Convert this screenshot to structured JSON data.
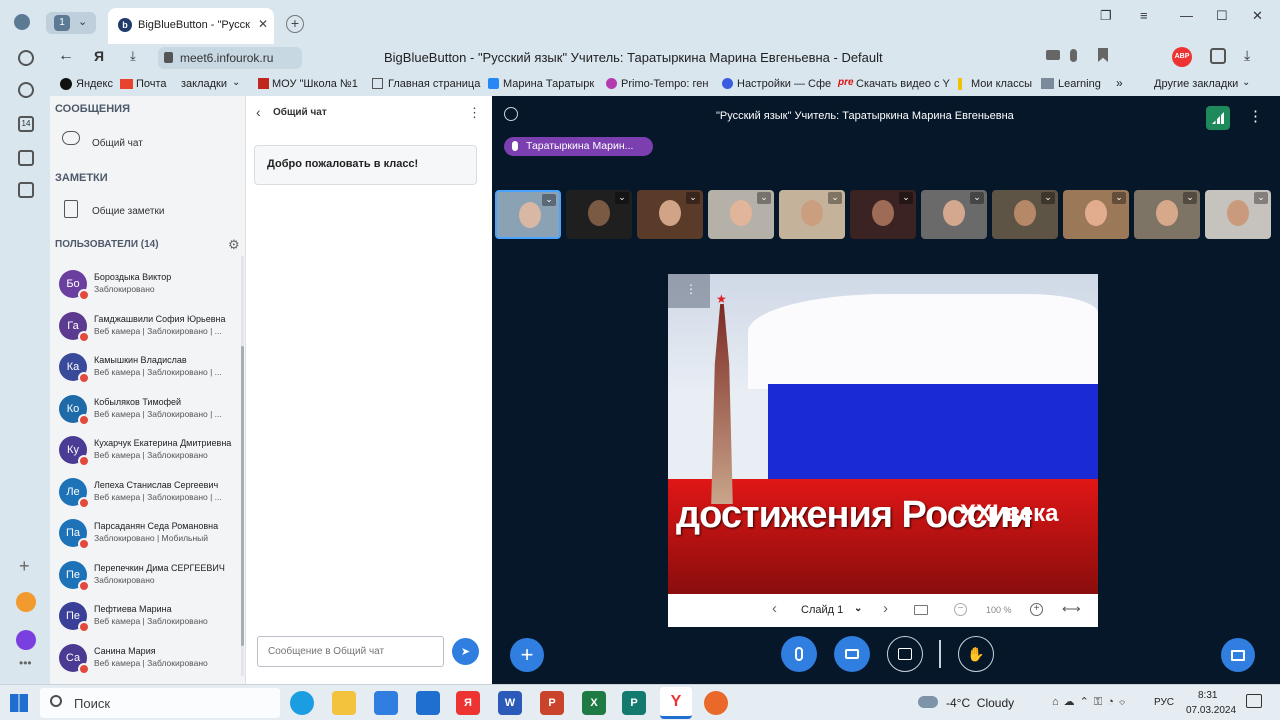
{
  "browser": {
    "tab_count": "1",
    "tab_title": "BigBlueButton - \"Русск",
    "url": "meet6.infourok.ru",
    "page_title": "BigBlueButton - \"Русский язык\" Учитель: Таратыркина Марина Евгеньевна - Default",
    "bookmarks": [
      "Яндекс",
      "Почта",
      "закладки",
      "МОУ \"Школа №1",
      "Главная страница",
      "Марина Таратырк",
      "Primo-Tempo: ген",
      "Настройки — Сфе",
      "Скачать видео с Y",
      "Мои классы",
      "Learning",
      "Другие закладки"
    ]
  },
  "sidebar": {
    "messages_header": "СООБЩЕНИЯ",
    "public_chat": "Общий чат",
    "notes_header": "ЗАМЕТКИ",
    "shared_notes": "Общие заметки",
    "users_header": "ПОЛЬЗОВАТЕЛИ (14)",
    "users": [
      {
        "initials": "Бо",
        "name": "Бороздыка Виктор",
        "status": "Заблокировано",
        "color": "#6b3fa0"
      },
      {
        "initials": "Га",
        "name": "Гамджашвили София Юрьевна",
        "status": "Веб камера | Заблокировано | ...",
        "color": "#5c3a8f"
      },
      {
        "initials": "Ка",
        "name": "Камышкин Владислав",
        "status": "Веб камера | Заблокировано | ...",
        "color": "#3a4a9a"
      },
      {
        "initials": "Ко",
        "name": "Кобыляков Тимофей",
        "status": "Веб камера | Заблокировано | ...",
        "color": "#1f6aa8"
      },
      {
        "initials": "Ку",
        "name": "Кухарчук Екатерина Дмитриевна",
        "status": "Веб камера | Заблокировано",
        "color": "#4a3c94"
      },
      {
        "initials": "Ле",
        "name": "Лепеха Станислав Сергеевич",
        "status": "Веб камера | Заблокировано | ...",
        "color": "#1d72b8"
      },
      {
        "initials": "Па",
        "name": "Парсаданян Седа Романовна",
        "status": "Заблокировано | Мобильный",
        "color": "#1d72b8"
      },
      {
        "initials": "Пе",
        "name": "Перепечкин Дима СЕРГЕЕВИЧ",
        "status": "Заблокировано",
        "color": "#1d72b8"
      },
      {
        "initials": "Пе",
        "name": "Пефтиева Марина",
        "status": "Веб камера | Заблокировано",
        "color": "#3a3f98"
      },
      {
        "initials": "Са",
        "name": "Санина Мария",
        "status": "Веб камера | Заблокировано",
        "color": "#4b3a92"
      }
    ]
  },
  "chat": {
    "back_label": "Общий чат",
    "welcome": "Добро пожаловать в класс!",
    "input_placeholder": "Сообщение в Общий чат"
  },
  "main": {
    "title": "\"Русский язык\" Учитель: Таратыркина Марина Евгеньевна",
    "speaker": "Таратыркина Марин...",
    "slide_text_1": "достижения России",
    "slide_text_2": "XXI века",
    "slide_label": "Слайд 1",
    "zoom": "100 %"
  },
  "taskbar": {
    "search": "Поиск",
    "weather": "-4°C  Cloudy",
    "lang": "РУС",
    "time": "8:31",
    "date": "07.03.2024"
  }
}
